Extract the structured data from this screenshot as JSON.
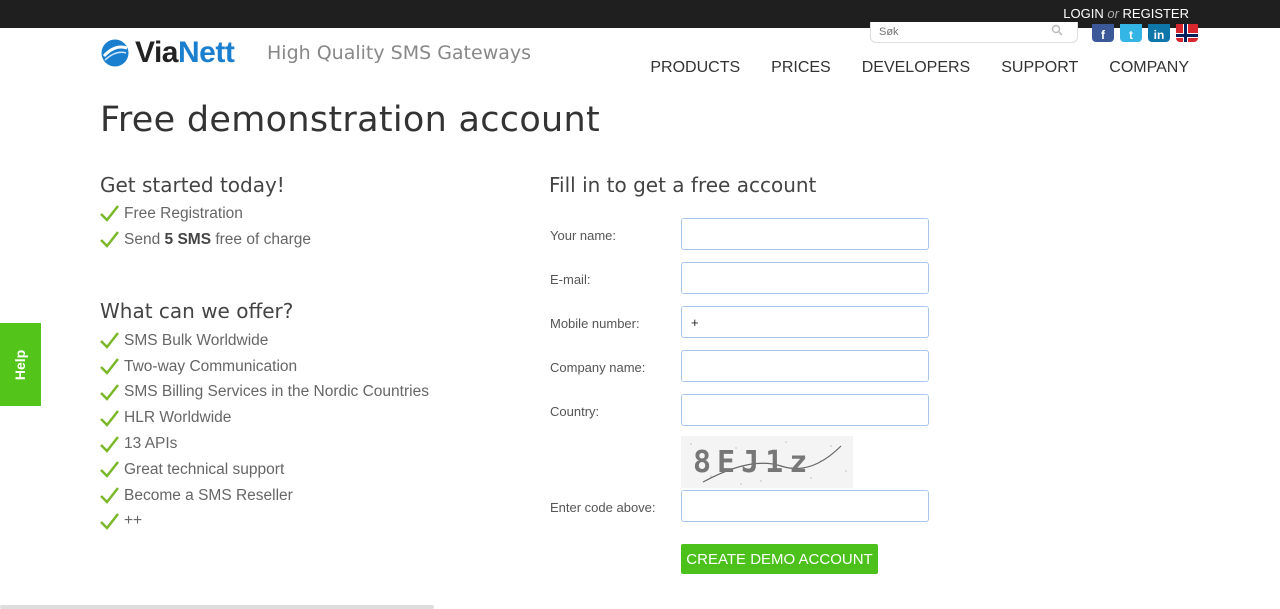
{
  "topbar": {
    "login": "LOGIN",
    "or": "or",
    "register": "REGISTER"
  },
  "search": {
    "placeholder": "Søk"
  },
  "social": [
    "facebook-icon",
    "twitter-icon",
    "linkedin-icon",
    "norway-flag-icon"
  ],
  "logo": {
    "via": "Via",
    "nett": "Nett",
    "tagline": "High Quality SMS Gateways"
  },
  "nav": [
    "PRODUCTS",
    "PRICES",
    "DEVELOPERS",
    "SUPPORT",
    "COMPANY"
  ],
  "page_title": "Free demonstration account",
  "get_started": {
    "heading": "Get started today!",
    "item1": "Free Registration",
    "item2_pre": "Send ",
    "item2_bold": "5 SMS",
    "item2_post": " free of charge"
  },
  "offer": {
    "heading": "What can we offer?",
    "items": [
      "SMS Bulk Worldwide",
      "Two-way Communication",
      "SMS Billing Services in the Nordic Countries",
      "HLR Worldwide",
      "13 APIs",
      "Great technical support",
      "Become a SMS Reseller",
      "++"
    ]
  },
  "form": {
    "heading": "Fill in to get a free account",
    "name_label": "Your name:",
    "email_label": "E-mail:",
    "mobile_label": "Mobile number:",
    "mobile_value": "+",
    "company_label": "Company name:",
    "country_label": "Country:",
    "captcha_text": "8EJ1z",
    "code_label": "Enter code above:",
    "submit": "CREATE DEMO ACCOUNT"
  },
  "help": "Help",
  "colors": {
    "topbar": "#1f1f1f",
    "accent_green": "#4cc11c",
    "brand_blue": "#1a7fcf",
    "check_green": "#7ab829"
  }
}
